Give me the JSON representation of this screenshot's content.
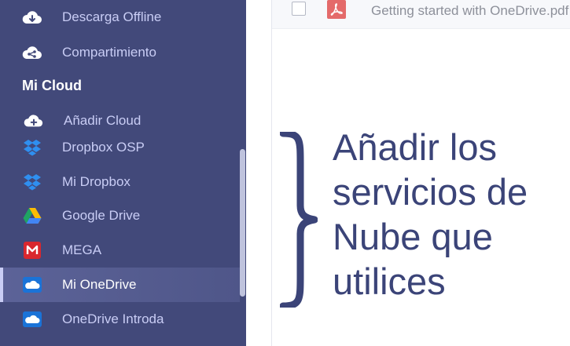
{
  "sidebar": {
    "section_title": "Mi Cloud",
    "items": [
      {
        "label": "Descarga Offline",
        "icon": "cloud-download-icon"
      },
      {
        "label": "Compartimiento",
        "icon": "cloud-share-icon"
      },
      {
        "label": "Añadir Cloud",
        "icon": "cloud-add-icon"
      },
      {
        "label": "Dropbox OSP",
        "icon": "dropbox-icon"
      },
      {
        "label": "Mi Dropbox",
        "icon": "dropbox-icon"
      },
      {
        "label": "Google Drive",
        "icon": "google-drive-icon"
      },
      {
        "label": "MEGA",
        "icon": "mega-icon"
      },
      {
        "label": "Mi OneDrive",
        "icon": "onedrive-icon",
        "active": true
      },
      {
        "label": "OneDrive Introda",
        "icon": "onedrive-icon"
      }
    ]
  },
  "file_list": {
    "rows": [
      {
        "name": "Getting started with OneDrive.pdf",
        "icon": "pdf-icon"
      }
    ]
  },
  "annotation": {
    "text": "Añadir los servicios de Nube que utilices"
  },
  "colors": {
    "sidebar_bg": "#42497a",
    "sidebar_text": "#c9cdf5",
    "annotation_text": "#3b4478",
    "pdf_red": "#e46a6a"
  }
}
